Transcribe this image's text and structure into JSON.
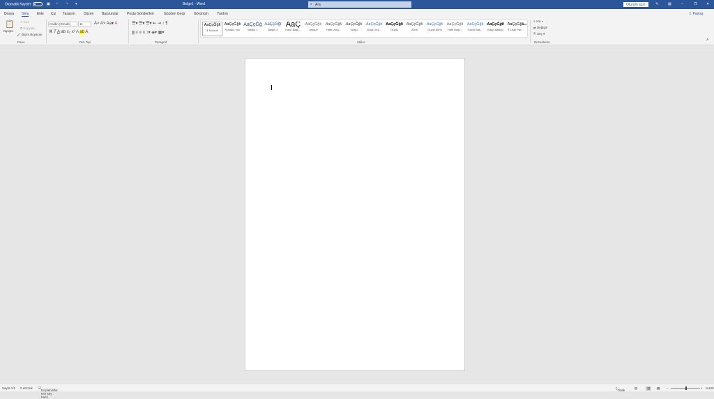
{
  "titlebar": {
    "autosave_label": "Otomatik Kaydet",
    "title": "Belge1 - Word",
    "search_placeholder": "Ara",
    "signin": "Oturum açın"
  },
  "tabs": [
    "Dosya",
    "Giriş",
    "Ekle",
    "Çiz",
    "Tasarım",
    "Düzen",
    "Başvurular",
    "Posta Gönderileri",
    "Gözden Geçir",
    "Görünüm",
    "Yardım"
  ],
  "share": "Paylaş",
  "clipboard": {
    "paste": "Yapıştır",
    "cut": "Kes",
    "copy": "Kopyala",
    "format_painter": "Biçim Boyacısı",
    "group": "Pano"
  },
  "font": {
    "name": "Calibri (Gövde)",
    "size": "11",
    "group": "Yazı Tipi"
  },
  "paragraph": {
    "group": "Paragraf"
  },
  "styles": {
    "group": "Stiller",
    "items": [
      {
        "sample": "AaÇçĞğIi",
        "name": "¶ Normal"
      },
      {
        "sample": "AaÇçĞğIi",
        "name": "¶ Aralık Yok"
      },
      {
        "sample": "AaÇçĞğ",
        "name": "Başlık 1"
      },
      {
        "sample": "AaÇçĞğI",
        "name": "Başlık 2"
      },
      {
        "sample": "AaÇ",
        "name": "Konu Başlı..."
      },
      {
        "sample": "AaÇçĞğIı",
        "name": "Altyazı"
      },
      {
        "sample": "AaÇçĞğIi",
        "name": "Hafif Vurg..."
      },
      {
        "sample": "AaÇçĞğIi",
        "name": "Vurgu"
      },
      {
        "sample": "AaÇçĞğIi",
        "name": "Güçlü Vur..."
      },
      {
        "sample": "AaÇçĞğIi",
        "name": "Güçlü"
      },
      {
        "sample": "AaÇçĞğIi",
        "name": "Alıntı"
      },
      {
        "sample": "AaÇçĞğIi",
        "name": "Güçlü Alıntı"
      },
      {
        "sample": "AaÇçĞğIi",
        "name": "Hafif Başv..."
      },
      {
        "sample": "AaÇçĞğIi",
        "name": "Güçlü Baş..."
      },
      {
        "sample": "AaÇçĞğIi",
        "name": "Kitap Başlığı"
      },
      {
        "sample": "AaÇçĞğIi",
        "name": "¶ Liste Par..."
      }
    ]
  },
  "editing": {
    "find": "Ara",
    "replace": "Değiştir",
    "select": "Seç",
    "group": "Düzenleme"
  },
  "status": {
    "page": "Sayfa 1/1",
    "words": "0 sözcük",
    "accessibility": "Erişilebilirlik: Her şey hazır",
    "focus": "Odak",
    "zoom": "%100",
    "zoom_level": 100
  },
  "colors": {
    "accent": "#2b579a"
  }
}
